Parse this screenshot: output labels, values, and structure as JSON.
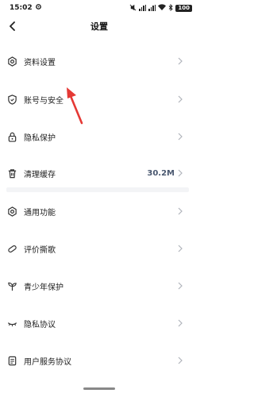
{
  "status_bar": {
    "time": "15:02",
    "time_icon": "settings-gear-icon",
    "battery": "100"
  },
  "header": {
    "title": "设置",
    "back_icon": "back-arrow-icon"
  },
  "items": [
    {
      "label": "资料设置",
      "icon": "gear-icon"
    },
    {
      "label": "账号与安全",
      "icon": "shield-icon"
    },
    {
      "label": "隐私保护",
      "icon": "lock-icon"
    },
    {
      "label": "清理缓存",
      "icon": "trash-icon",
      "value": "30.2M"
    },
    {
      "label": "通用功能",
      "icon": "gear-icon"
    },
    {
      "label": "评价撕歌",
      "icon": "pill-icon"
    },
    {
      "label": "青少年保护",
      "icon": "sprout-icon"
    },
    {
      "label": "隐私协议",
      "icon": "closed-eye-icon"
    },
    {
      "label": "用户服务协议",
      "icon": "document-icon"
    }
  ],
  "colors": {
    "annotation_arrow": "#e53935",
    "cache_value": "#4a5870",
    "divider": "#f3f4f6"
  }
}
